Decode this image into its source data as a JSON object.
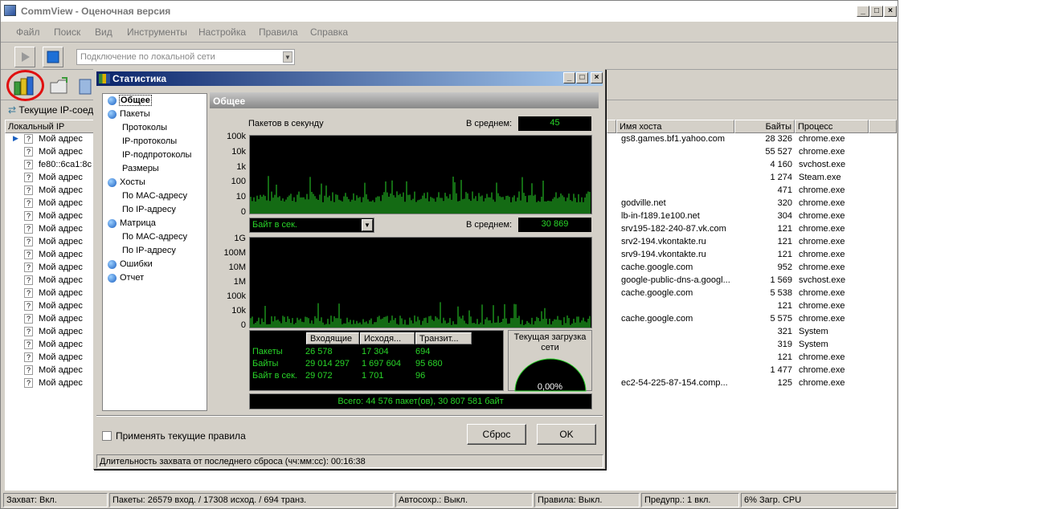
{
  "window": {
    "title": "CommView - Оценочная версия"
  },
  "menu": [
    "Файл",
    "Поиск",
    "Вид",
    "Инструменты",
    "Настройка",
    "Правила",
    "Справка"
  ],
  "toolbar": {
    "adapter": "Подключение по локальной сети"
  },
  "tab": {
    "label": "Текущие IP-соед"
  },
  "grid": {
    "headers": {
      "local_ip": "Локальный IP",
      "hostname": "Имя хоста",
      "bytes": "Байты",
      "process": "Процесс"
    },
    "rows": [
      {
        "mark": "?",
        "local": "Мой адрес",
        "host": "gs8.games.bf1.yahoo.com",
        "bytes": "28 326",
        "proc": "chrome.exe"
      },
      {
        "mark": "?",
        "local": "Мой адрес",
        "host": "",
        "bytes": "55 527",
        "proc": "chrome.exe"
      },
      {
        "mark": "?",
        "local": "fe80::6ca1:8c",
        "host": "",
        "bytes": "4 160",
        "proc": "svchost.exe"
      },
      {
        "mark": "?",
        "local": "Мой адрес",
        "host": "",
        "bytes": "1 274",
        "proc": "Steam.exe"
      },
      {
        "mark": "?",
        "local": "Мой адрес",
        "host": "",
        "bytes": "471",
        "proc": "chrome.exe"
      },
      {
        "mark": "?",
        "local": "Мой адрес",
        "host": "godville.net",
        "bytes": "320",
        "proc": "chrome.exe"
      },
      {
        "mark": "?",
        "local": "Мой адрес",
        "host": "lb-in-f189.1e100.net",
        "bytes": "304",
        "proc": "chrome.exe"
      },
      {
        "mark": "?",
        "local": "Мой адрес",
        "host": "srv195-182-240-87.vk.com",
        "bytes": "121",
        "proc": "chrome.exe"
      },
      {
        "mark": "?",
        "local": "Мой адрес",
        "host": "srv2-194.vkontakte.ru",
        "bytes": "121",
        "proc": "chrome.exe"
      },
      {
        "mark": "?",
        "local": "Мой адрес",
        "host": "srv9-194.vkontakte.ru",
        "bytes": "121",
        "proc": "chrome.exe"
      },
      {
        "mark": "?",
        "local": "Мой адрес",
        "host": "cache.google.com",
        "bytes": "952",
        "proc": "chrome.exe"
      },
      {
        "mark": "?",
        "local": "Мой адрес",
        "host": "google-public-dns-a.googl...",
        "bytes": "1 569",
        "proc": "svchost.exe"
      },
      {
        "mark": "?",
        "local": "Мой адрес",
        "host": "cache.google.com",
        "bytes": "5 538",
        "proc": "chrome.exe"
      },
      {
        "mark": "?",
        "local": "Мой адрес",
        "host": "",
        "bytes": "121",
        "proc": "chrome.exe"
      },
      {
        "mark": "?",
        "local": "Мой адрес",
        "host": "cache.google.com",
        "bytes": "5 575",
        "proc": "chrome.exe"
      },
      {
        "mark": "?",
        "local": "Мой адрес",
        "host": "",
        "bytes": "321",
        "proc": "System"
      },
      {
        "mark": "?",
        "local": "Мой адрес",
        "host": "",
        "bytes": "319",
        "proc": "System"
      },
      {
        "mark": "?",
        "local": "Мой адрес",
        "host": "",
        "bytes": "121",
        "proc": "chrome.exe"
      },
      {
        "mark": "?",
        "local": "Мой адрес",
        "host": "",
        "bytes": "1 477",
        "proc": "chrome.exe"
      },
      {
        "mark": "?",
        "local": "Мой адрес",
        "host": "ec2-54-225-87-154.comp...",
        "bytes": "125",
        "proc": "chrome.exe"
      }
    ]
  },
  "status": {
    "capture": "Захват: Вкл.",
    "packets": "Пакеты: 26579 вход. / 17308 исход. / 694 транз.",
    "autosave": "Автосохр.: Выкл.",
    "rules": "Правила: Выкл.",
    "warnings": "Предупр.: 1 вкл.",
    "cpu": "6% Загр. CPU"
  },
  "dialog": {
    "title": "Статистика",
    "tree": [
      {
        "label": "Общее",
        "level": 0
      },
      {
        "label": "Пакеты",
        "level": 0
      },
      {
        "label": "Протоколы",
        "level": 1
      },
      {
        "label": "IP-протоколы",
        "level": 1
      },
      {
        "label": "IP-подпротоколы",
        "level": 1
      },
      {
        "label": "Размеры",
        "level": 1
      },
      {
        "label": "Хосты",
        "level": 0
      },
      {
        "label": "По MAC-адресу",
        "level": 1
      },
      {
        "label": "По IP-адресу",
        "level": 1
      },
      {
        "label": "Матрица",
        "level": 0
      },
      {
        "label": "По MAC-адресу",
        "level": 1
      },
      {
        "label": "По IP-адресу",
        "level": 1
      },
      {
        "label": "Ошибки",
        "level": 0
      },
      {
        "label": "Отчет",
        "level": 0
      }
    ],
    "panel_title": "Общее",
    "pps_label": "Пакетов в секунду",
    "avg_label": "В среднем:",
    "avg_packets": "45",
    "avg_bytes": "30 869",
    "unit_select": "Байт в сек.",
    "yticks1": [
      "100k",
      "10k",
      "1k",
      "100",
      "10",
      "0"
    ],
    "yticks2": [
      "1G",
      "100M",
      "10M",
      "1M",
      "100k",
      "10k",
      "0"
    ],
    "table": {
      "headers": [
        "Входящие",
        "Исходя...",
        "Транзит..."
      ],
      "rows": [
        {
          "name": "Пакеты",
          "in": "26 578",
          "out": "17 304",
          "tr": "694"
        },
        {
          "name": "Байты",
          "in": "29 014 297",
          "out": "1 697 604",
          "tr": "95 680"
        },
        {
          "name": "Байт в сек.",
          "in": "29 072",
          "out": "1 701",
          "tr": "96"
        }
      ]
    },
    "load_title": "Текущая загрузка сети",
    "load_value": "0,00%",
    "total": "Всего: 44 576 пакет(ов), 30 807 581 байт",
    "apply_rules": "Применять текущие правила",
    "reset": "Сброс",
    "ok": "OK",
    "duration": "Длительность захвата от последнего сброса (чч:мм:сс): 00:16:38"
  }
}
